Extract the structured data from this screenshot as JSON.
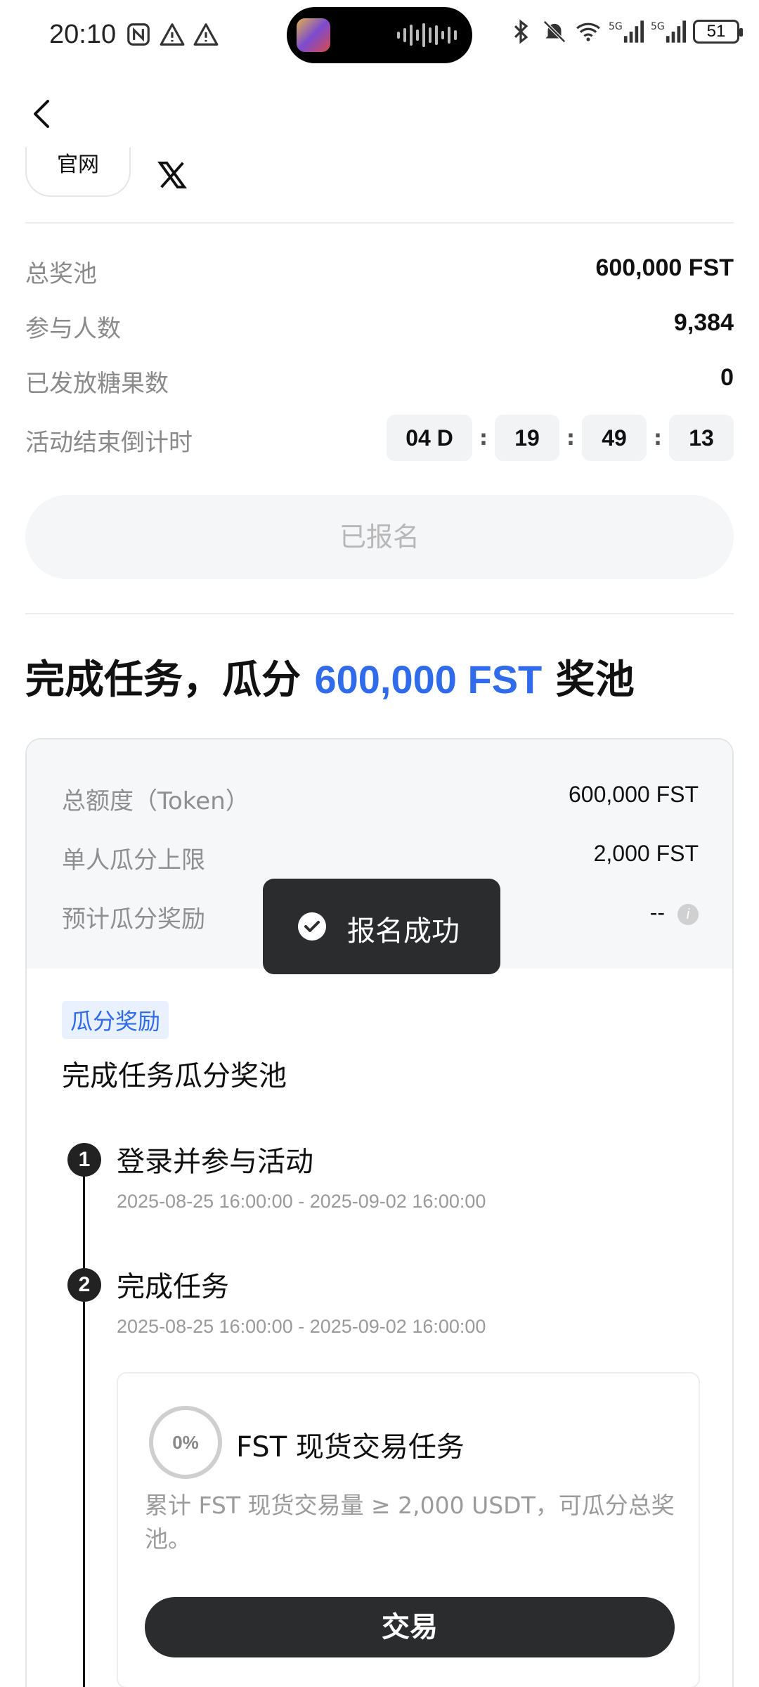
{
  "status_bar": {
    "time": "20:10",
    "battery": "51"
  },
  "social": {
    "official_site_label": "官网"
  },
  "stats": {
    "total_pool_label": "总奖池",
    "total_pool_value": "600,000 FST",
    "participants_label": "参与人数",
    "participants_value": "9,384",
    "candy_issued_label": "已发放糖果数",
    "candy_issued_value": "0",
    "countdown_label": "活动结束倒计时",
    "countdown": {
      "days": "04 D",
      "hours": "19",
      "minutes": "49",
      "seconds": "13",
      "separator": ":"
    }
  },
  "register_button_label": "已报名",
  "section": {
    "title_prefix": "完成任务，瓜分 ",
    "title_highlight": "600,000 FST",
    "title_suffix": " 奖池"
  },
  "card": {
    "total_amount_label": "总额度（Token）",
    "total_amount_value": "600,000 FST",
    "per_user_cap_label": "单人瓜分上限",
    "per_user_cap_value": "2,000 FST",
    "estimated_reward_label": "预计瓜分奖励",
    "estimated_reward_value": "--",
    "reward_badge": "瓜分奖励",
    "reward_desc": "完成任务瓜分奖池",
    "steps": [
      {
        "num": "1",
        "title": "登录并参与活动",
        "time": "2025-08-25 16:00:00 - 2025-09-02 16:00:00"
      },
      {
        "num": "2",
        "title": "完成任务",
        "time": "2025-08-25 16:00:00 - 2025-09-02 16:00:00"
      }
    ],
    "task": {
      "progress": "0%",
      "title": "FST 现货交易任务",
      "description": "累计 FST 现货交易量 ≥ 2,000 USDT，可瓜分总奖池。",
      "button_label": "交易"
    }
  },
  "toast": {
    "message": "报名成功"
  },
  "colors": {
    "accent_blue": "#2f6bea",
    "dark_button": "#2b2c2e",
    "muted_text": "#8a8a8a"
  }
}
